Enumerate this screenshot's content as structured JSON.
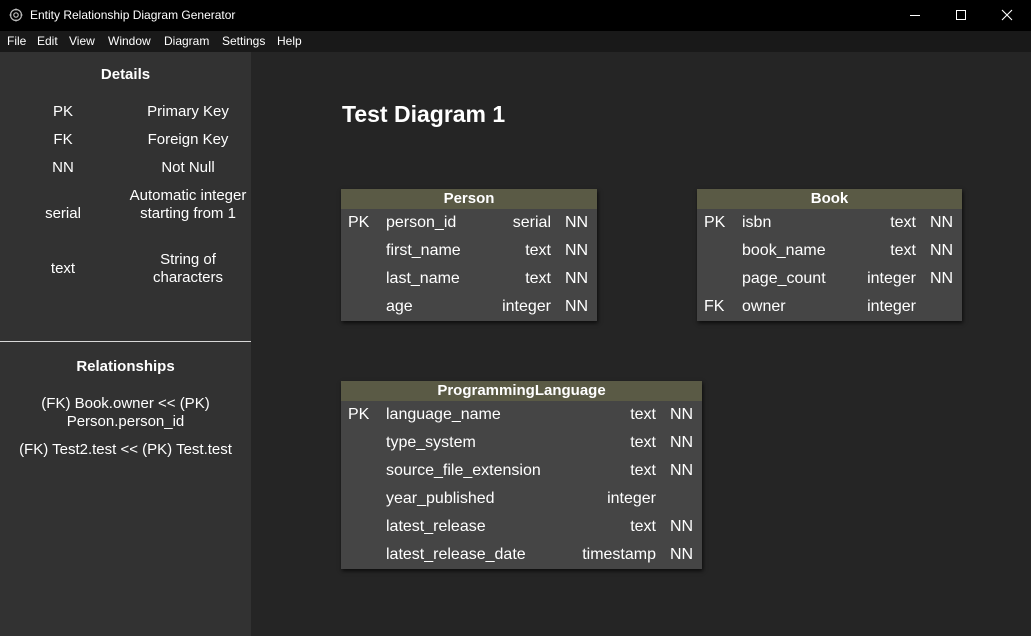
{
  "window": {
    "title": "Entity Relationship Diagram Generator",
    "icon": "gear-icon",
    "controls": [
      "minimize-icon",
      "maximize-icon",
      "close-icon"
    ]
  },
  "menu": [
    "File",
    "Edit",
    "View",
    "Window",
    "Diagram",
    "Settings",
    "Help"
  ],
  "details": {
    "heading": "Details",
    "items": [
      {
        "abbr": "PK",
        "desc": "Primary Key"
      },
      {
        "abbr": "FK",
        "desc": "Foreign Key"
      },
      {
        "abbr": "NN",
        "desc": "Not Null"
      },
      {
        "abbr": "serial",
        "desc": "Automatic integer starting from 1"
      },
      {
        "abbr": "text",
        "desc": "String of characters"
      }
    ]
  },
  "relationships": {
    "heading": "Relationships",
    "items": [
      "(FK) Book.owner << (PK) Person.person_id",
      "(FK) Test2.test << (PK) Test.test"
    ]
  },
  "diagram": {
    "title": "Test Diagram 1",
    "colors": {
      "canvas": "#252525",
      "table_body": "#454545",
      "table_header": "#5a5a45",
      "sidebar": "#323232"
    },
    "tables": [
      {
        "name": "Person",
        "columns": [
          {
            "key": "PK",
            "name": "person_id",
            "type": "serial",
            "nn": "NN"
          },
          {
            "key": "",
            "name": "first_name",
            "type": "text",
            "nn": "NN"
          },
          {
            "key": "",
            "name": "last_name",
            "type": "text",
            "nn": "NN"
          },
          {
            "key": "",
            "name": "age",
            "type": "integer",
            "nn": "NN"
          }
        ]
      },
      {
        "name": "Book",
        "columns": [
          {
            "key": "PK",
            "name": "isbn",
            "type": "text",
            "nn": "NN"
          },
          {
            "key": "",
            "name": "book_name",
            "type": "text",
            "nn": "NN"
          },
          {
            "key": "",
            "name": "page_count",
            "type": "integer",
            "nn": "NN"
          },
          {
            "key": "FK",
            "name": "owner",
            "type": "integer",
            "nn": ""
          }
        ]
      },
      {
        "name": "ProgrammingLanguage",
        "columns": [
          {
            "key": "PK",
            "name": "language_name",
            "type": "text",
            "nn": "NN"
          },
          {
            "key": "",
            "name": "type_system",
            "type": "text",
            "nn": "NN"
          },
          {
            "key": "",
            "name": "source_file_extension",
            "type": "text",
            "nn": "NN"
          },
          {
            "key": "",
            "name": "year_published",
            "type": "integer",
            "nn": ""
          },
          {
            "key": "",
            "name": "latest_release",
            "type": "text",
            "nn": "NN"
          },
          {
            "key": "",
            "name": "latest_release_date",
            "type": "timestamp",
            "nn": "NN"
          }
        ]
      }
    ]
  }
}
